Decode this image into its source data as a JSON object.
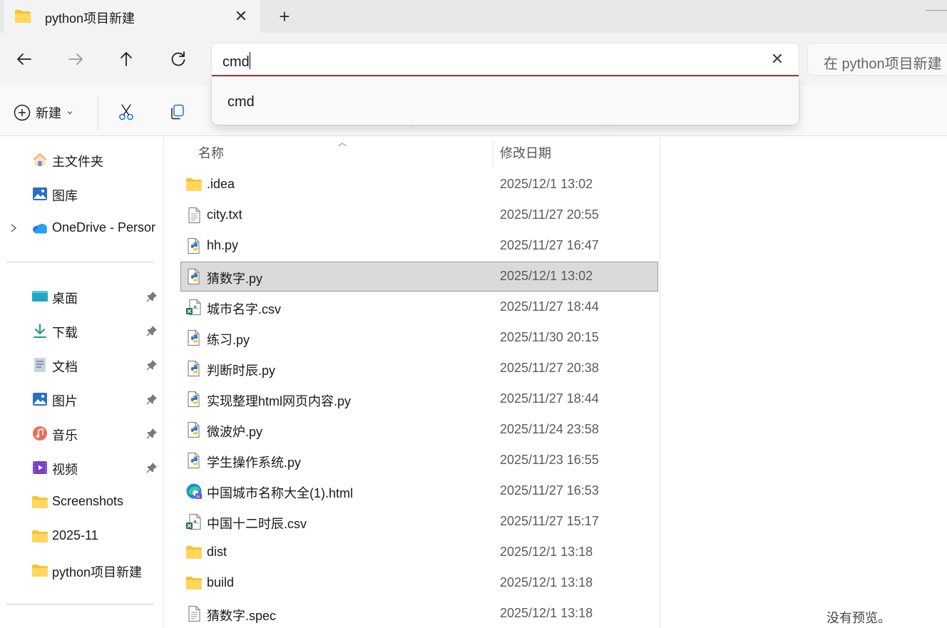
{
  "tab": {
    "title": "python项目新建"
  },
  "address": {
    "value": "cmd"
  },
  "search": {
    "placeholder": "在 python项目新建"
  },
  "suggestions": [
    {
      "label": "cmd"
    }
  ],
  "commandbar": {
    "new_label": "新建"
  },
  "sidebar": {
    "top": [
      {
        "label": "主文件夹",
        "icon": "home-icon"
      },
      {
        "label": "图库",
        "icon": "gallery-icon"
      },
      {
        "label": "OneDrive - Persor",
        "icon": "onedrive-icon"
      }
    ],
    "pinned": [
      {
        "label": "桌面",
        "icon": "desktop-icon",
        "pinned": true
      },
      {
        "label": "下载",
        "icon": "download-icon",
        "pinned": true
      },
      {
        "label": "文档",
        "icon": "document-icon",
        "pinned": true
      },
      {
        "label": "图片",
        "icon": "pictures-icon",
        "pinned": true
      },
      {
        "label": "音乐",
        "icon": "music-icon",
        "pinned": true
      },
      {
        "label": "视频",
        "icon": "videos-icon",
        "pinned": true
      },
      {
        "label": "Screenshots",
        "icon": "folder-icon",
        "pinned": false
      },
      {
        "label": "2025-11",
        "icon": "folder-icon",
        "pinned": false
      },
      {
        "label": "python项目新建",
        "icon": "folder-icon",
        "pinned": false
      }
    ]
  },
  "columns": {
    "name": "名称",
    "modified": "修改日期"
  },
  "files": [
    {
      "name": ".idea",
      "date": "2025/12/1 13:02",
      "type": "folder"
    },
    {
      "name": "city.txt",
      "date": "2025/11/27 20:55",
      "type": "text"
    },
    {
      "name": "hh.py",
      "date": "2025/11/27 16:47",
      "type": "python"
    },
    {
      "name": "猜数字.py",
      "date": "2025/12/1 13:02",
      "type": "python",
      "selected": true
    },
    {
      "name": "城市名字.csv",
      "date": "2025/11/27 18:44",
      "type": "csv"
    },
    {
      "name": "练习.py",
      "date": "2025/11/30 20:15",
      "type": "python"
    },
    {
      "name": "判断时辰.py",
      "date": "2025/11/27 20:38",
      "type": "python"
    },
    {
      "name": "实现整理html网页内容.py",
      "date": "2025/11/27 18:44",
      "type": "python"
    },
    {
      "name": "微波炉.py",
      "date": "2025/11/24 23:58",
      "type": "python"
    },
    {
      "name": "学生操作系统.py",
      "date": "2025/11/23 16:55",
      "type": "python"
    },
    {
      "name": "中国城市名称大全(1).html",
      "date": "2025/11/27 16:53",
      "type": "html"
    },
    {
      "name": "中国十二时辰.csv",
      "date": "2025/11/27 15:17",
      "type": "csv"
    },
    {
      "name": "dist",
      "date": "2025/12/1 13:18",
      "type": "folder"
    },
    {
      "name": "build",
      "date": "2025/12/1 13:18",
      "type": "folder"
    },
    {
      "name": "猜数字.spec",
      "date": "2025/12/1 13:18",
      "type": "text"
    }
  ],
  "preview": {
    "message": "没有预览。"
  }
}
